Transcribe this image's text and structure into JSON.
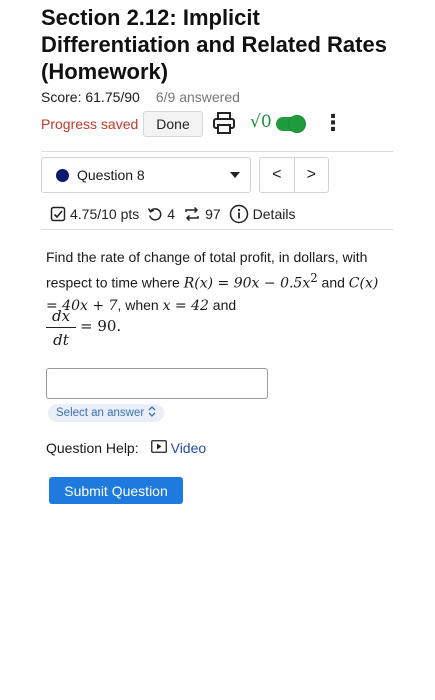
{
  "assignment": {
    "title": "Section 2.12: Implicit Differentiation and Related Rates (Homework)",
    "score": "Score: 61.75/90",
    "answered": "6/9 answered"
  },
  "toolbar": {
    "progress_saved": "Progress saved",
    "done_label": "Done",
    "math_icon_text": "√0"
  },
  "question_nav": {
    "selected_question": "Question 8",
    "prev_label": "<",
    "next_label": ">"
  },
  "question_stats": {
    "points": "4.75/10 pts",
    "attempts": "4",
    "submissions": "97",
    "details_label": "Details"
  },
  "question": {
    "part1": "Find the rate of change of total profit, in dollars, with respect to time where ",
    "revenue_fn": "R(x) = 90x − 0.5x",
    "revenue_exp": "2",
    "part2": " and ",
    "cost_fn": "C(x) = 40x + 7",
    "part3": ", when ",
    "x_value": "x = 42",
    "part4": " and",
    "rate_num": "dx",
    "rate_den": "dt",
    "rate_value": "= 90."
  },
  "answer": {
    "value": "",
    "placeholder": "",
    "select_label": "Select an answer"
  },
  "help": {
    "label": "Question Help:",
    "video_label": "Video"
  },
  "submit": {
    "label": "Submit Question"
  },
  "colors": {
    "progress_saved": "#c0392b",
    "toggle_on": "#1f9d3e",
    "submit_button": "#1f7ae0",
    "question_dot": "#0b1a6e",
    "link": "#1f4fa8"
  }
}
